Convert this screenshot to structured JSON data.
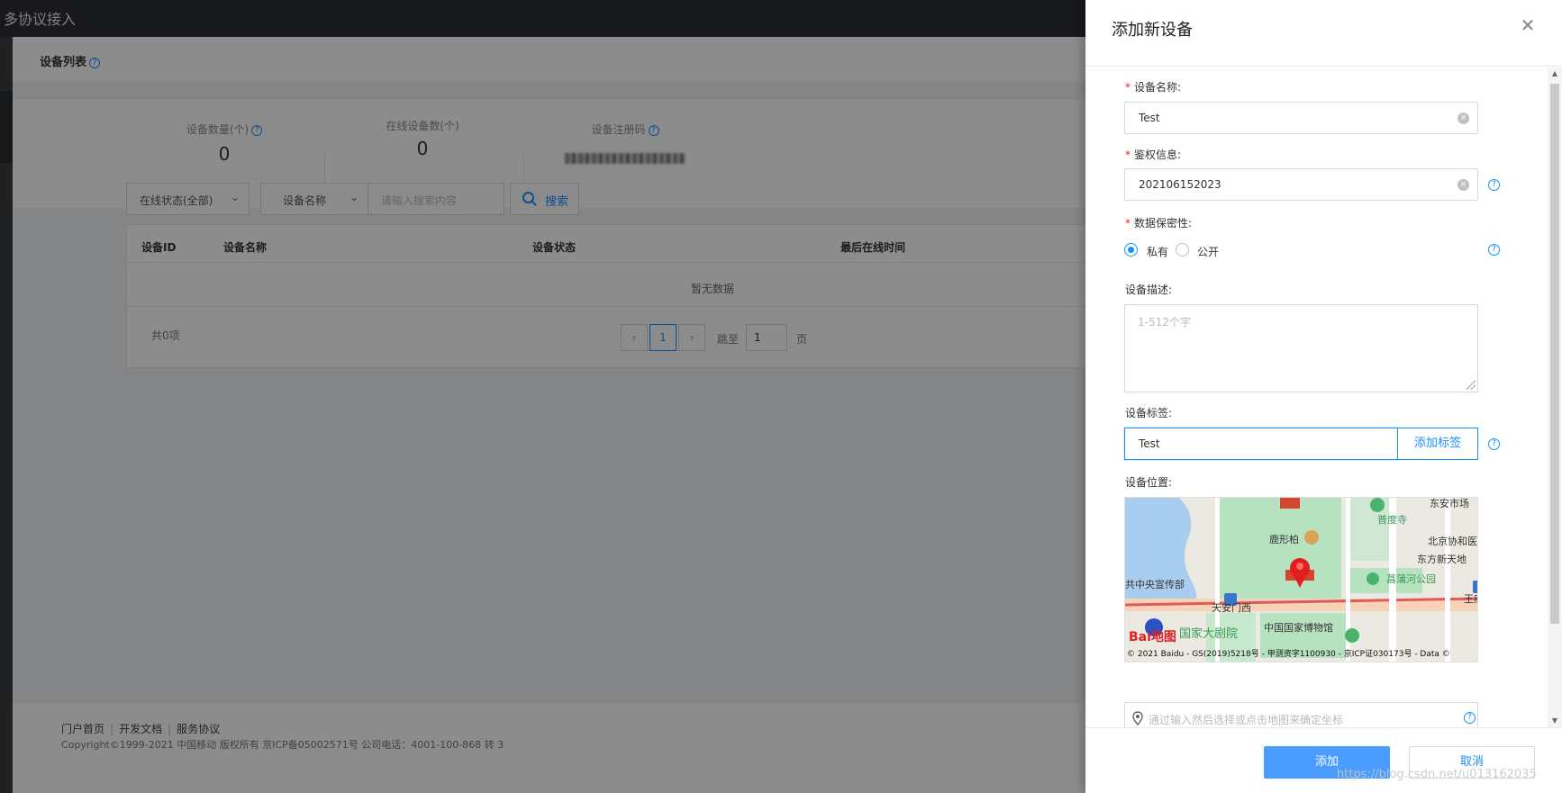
{
  "app": {
    "title": "多协议接入"
  },
  "page": {
    "title": "设备列表",
    "stats": [
      {
        "label": "设备数量(个)",
        "value": "0"
      },
      {
        "label": "在线设备数(个)",
        "value": "0"
      },
      {
        "label": "设备注册码",
        "value": ""
      }
    ],
    "filters": {
      "status_select": "在线状态(全部)",
      "field_select": "设备名称",
      "search_placeholder": "请输入搜索内容",
      "search_button": "搜索"
    },
    "table": {
      "columns": [
        "设备ID",
        "设备名称",
        "设备状态",
        "最后在线时间"
      ],
      "empty_text": "暂无数据",
      "total_text": "共0项"
    },
    "pagination": {
      "current_page": "1",
      "jump_label": "跳至",
      "jump_value": "1",
      "page_unit": "页"
    },
    "footer": {
      "links": [
        "门户首页",
        "开发文档",
        "服务协议"
      ],
      "copyright": "Copyright©1999-2021 中国移动 版权所有 京ICP备05002571号 公司电话：4001-100-868 转 3"
    }
  },
  "drawer": {
    "title": "添加新设备",
    "fields": {
      "name_label": "设备名称:",
      "name_value": "Test",
      "auth_label": "鉴权信息:",
      "auth_value": "202106152023",
      "privacy_label": "数据保密性:",
      "privacy_options": [
        "私有",
        "公开"
      ],
      "privacy_selected": "私有",
      "desc_label": "设备描述:",
      "desc_placeholder": "1-512个字",
      "tags_label": "设备标签:",
      "tags_value": "Test",
      "add_tag_button": "添加标签",
      "location_label": "设备位置:",
      "location_placeholder": "通过输入然后选择或点击地图来确定坐标"
    },
    "map": {
      "labels": [
        "普度寺",
        "鹿形柏",
        "北京协和医",
        "东方新天地",
        "共中央宣传部",
        "菖蒲河公园",
        "天安门西",
        "王府",
        "国家大剧院",
        "中国国家博物馆",
        "东安市场"
      ],
      "logo_text": "Bai地图",
      "copyright": "© 2021 Baidu - GS(2019)5218号 - 甲测资字1100930 - 京ICP证030173号 - Data ©"
    },
    "buttons": {
      "submit": "添加",
      "cancel": "取消"
    }
  },
  "watermark": "https://blog.csdn.net/u013162035",
  "colors": {
    "accent": "#1890ff",
    "primary_button": "#4a9dff",
    "required": "#f5222d",
    "topbar": "#2d2f33"
  }
}
